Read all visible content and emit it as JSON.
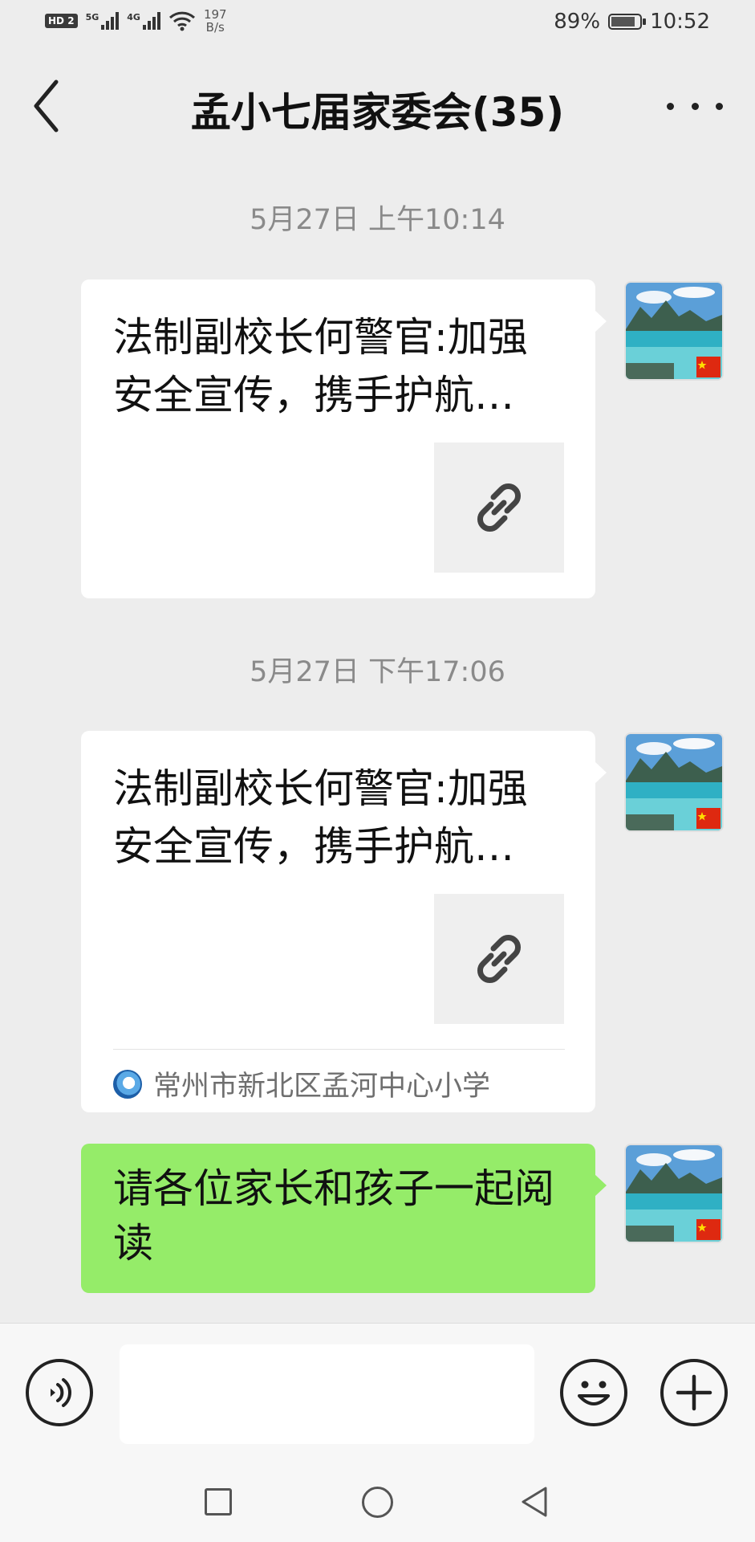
{
  "status_bar": {
    "hd_badge": "HD",
    "sim_badge": "2",
    "net1": "5G",
    "net2": "4G",
    "speed_value": "197",
    "speed_unit": "B/s",
    "battery_percent": "89%",
    "battery_level": 0.89,
    "time": "10:52"
  },
  "header": {
    "title": "孟小七届家委会(35)",
    "back_icon": "chevron-left-icon",
    "more_icon": "more-dots-icon"
  },
  "messages": [
    {
      "timestamp": "5月27日 上午10:14",
      "type": "link",
      "title": "法制副校长何警官:加强安全宣传，携手护航…",
      "thumb_icon": "link-icon"
    },
    {
      "timestamp": "5月27日 下午17:06",
      "type": "link",
      "title": "法制副校长何警官:加强安全宣传，携手护航…",
      "thumb_icon": "link-icon",
      "source": "常州市新北区孟河中心小学"
    },
    {
      "type": "text",
      "text": "请各位家长和孩子一起阅读",
      "bubble_color": "#95ec69"
    }
  ],
  "input_bar": {
    "placeholder": "",
    "voice_icon": "voice-icon",
    "emoji_icon": "emoji-icon",
    "plus_icon": "plus-icon"
  },
  "nav_bar": {
    "icons": [
      "square-recent-icon",
      "circle-home-icon",
      "triangle-back-icon"
    ]
  }
}
